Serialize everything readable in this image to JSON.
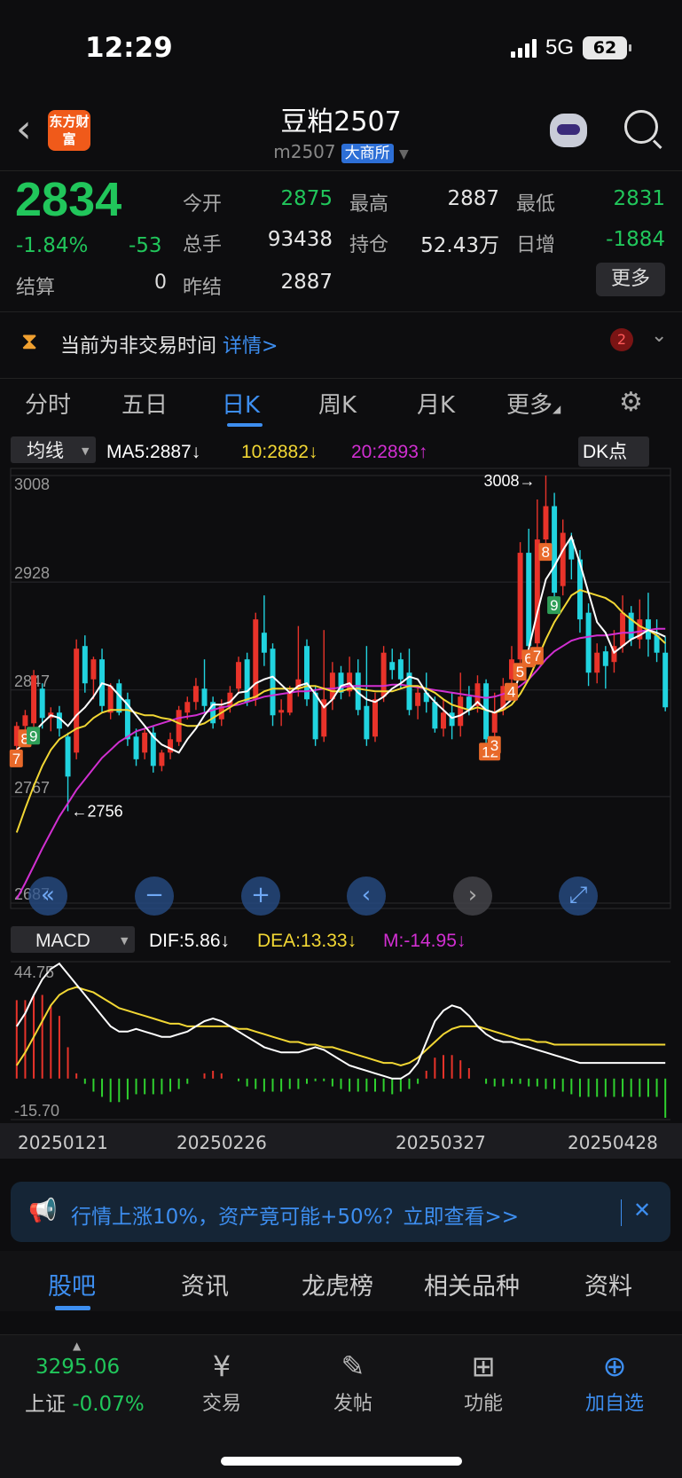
{
  "status": {
    "time": "12:29",
    "network": "5G",
    "battery": "62"
  },
  "header": {
    "logo": "东方财富",
    "title": "豆粕2507",
    "code": "m2507",
    "exchange": "大商所"
  },
  "quote": {
    "price": "2834",
    "pct": "-1.84%",
    "change": "-53",
    "settle_label": "结算",
    "settle_value": "0",
    "fields": [
      {
        "label": "今开",
        "value": "2875",
        "color": "green"
      },
      {
        "label": "最高",
        "value": "2887",
        "color": "white"
      },
      {
        "label": "最低",
        "value": "2831",
        "color": "green"
      },
      {
        "label": "总手",
        "value": "93438",
        "color": "white"
      },
      {
        "label": "持仓",
        "value": "52.43万",
        "color": "white"
      },
      {
        "label": "日增",
        "value": "-1884",
        "color": "green"
      },
      {
        "label": "昨结",
        "value": "2887",
        "color": "white"
      }
    ],
    "more": "更多"
  },
  "notice": {
    "text": "当前为非交易时间",
    "link": "详情>",
    "badge": "2"
  },
  "period_tabs": [
    "分时",
    "五日",
    "日K",
    "周K",
    "月K",
    "更多"
  ],
  "active_period": 2,
  "chart_data": {
    "type": "candlestick",
    "indicator_select": "均线",
    "ma_labels": {
      "ma5": "MA5:2887↓",
      "ma10": "10:2882↓",
      "ma20": "20:2893↑"
    },
    "dk_button": "DK点",
    "y_ticks": [
      "3008",
      "2928",
      "2847",
      "2767",
      "2687"
    ],
    "ylim": [
      2687,
      3008
    ],
    "max_label": "3008→",
    "min_label": "←2756",
    "dates": [
      "20250121",
      "20250226",
      "20250327",
      "20250428"
    ],
    "candles": [
      [
        2805,
        2820,
        2790,
        2823
      ],
      [
        2820,
        2828,
        2805,
        2832
      ],
      [
        2822,
        2858,
        2815,
        2862
      ],
      [
        2848,
        2826,
        2818,
        2852
      ],
      [
        2826,
        2830,
        2816,
        2834
      ],
      [
        2830,
        2818,
        2812,
        2835
      ],
      [
        2812,
        2782,
        2756,
        2815
      ],
      [
        2800,
        2878,
        2795,
        2885
      ],
      [
        2880,
        2852,
        2845,
        2888
      ],
      [
        2855,
        2870,
        2840,
        2872
      ],
      [
        2870,
        2835,
        2830,
        2878
      ],
      [
        2830,
        2850,
        2825,
        2852
      ],
      [
        2852,
        2830,
        2828,
        2855
      ],
      [
        2840,
        2810,
        2805,
        2845
      ],
      [
        2812,
        2795,
        2790,
        2818
      ],
      [
        2800,
        2815,
        2795,
        2818
      ],
      [
        2815,
        2790,
        2785,
        2820
      ],
      [
        2790,
        2800,
        2786,
        2802
      ],
      [
        2800,
        2810,
        2795,
        2815
      ],
      [
        2808,
        2832,
        2805,
        2835
      ],
      [
        2830,
        2838,
        2825,
        2842
      ],
      [
        2838,
        2850,
        2832,
        2856
      ],
      [
        2848,
        2835,
        2830,
        2870
      ],
      [
        2838,
        2822,
        2818,
        2842
      ],
      [
        2825,
        2835,
        2820,
        2840
      ],
      [
        2835,
        2845,
        2830,
        2850
      ],
      [
        2848,
        2868,
        2845,
        2872
      ],
      [
        2870,
        2838,
        2835,
        2875
      ],
      [
        2840,
        2900,
        2835,
        2905
      ],
      [
        2890,
        2875,
        2865,
        2918
      ],
      [
        2878,
        2828,
        2820,
        2882
      ],
      [
        2830,
        2832,
        2820,
        2840
      ],
      [
        2830,
        2845,
        2828,
        2850
      ],
      [
        2848,
        2855,
        2842,
        2895
      ],
      [
        2880,
        2840,
        2835,
        2885
      ],
      [
        2845,
        2810,
        2805,
        2850
      ],
      [
        2812,
        2840,
        2808,
        2892
      ],
      [
        2840,
        2860,
        2832,
        2868
      ],
      [
        2860,
        2845,
        2840,
        2865
      ],
      [
        2846,
        2860,
        2842,
        2872
      ],
      [
        2860,
        2832,
        2828,
        2870
      ],
      [
        2835,
        2810,
        2805,
        2880
      ],
      [
        2812,
        2840,
        2808,
        2845
      ],
      [
        2842,
        2875,
        2838,
        2880
      ],
      [
        2868,
        2862,
        2855,
        2878
      ],
      [
        2870,
        2855,
        2848,
        2875
      ],
      [
        2860,
        2832,
        2828,
        2878
      ],
      [
        2835,
        2845,
        2825,
        2850
      ],
      [
        2845,
        2838,
        2830,
        2860
      ],
      [
        2838,
        2818,
        2815,
        2842
      ],
      [
        2818,
        2830,
        2812,
        2840
      ],
      [
        2830,
        2820,
        2810,
        2845
      ],
      [
        2820,
        2842,
        2812,
        2860
      ],
      [
        2842,
        2832,
        2828,
        2850
      ],
      [
        2835,
        2852,
        2830,
        2858
      ],
      [
        2852,
        2810,
        2806,
        2855
      ],
      [
        2815,
        2830,
        2810,
        2845
      ],
      [
        2832,
        2850,
        2828,
        2856
      ],
      [
        2855,
        2870,
        2850,
        2880
      ],
      [
        2870,
        2950,
        2865,
        2958
      ],
      [
        2950,
        2880,
        2875,
        2968
      ],
      [
        2882,
        2960,
        2878,
        2990
      ],
      [
        2960,
        2985,
        2950,
        3008
      ],
      [
        2985,
        2920,
        2912,
        2995
      ],
      [
        2925,
        2965,
        2918,
        2975
      ],
      [
        2960,
        2945,
        2930,
        2965
      ],
      [
        2945,
        2900,
        2890,
        2952
      ],
      [
        2905,
        2860,
        2850,
        2912
      ],
      [
        2860,
        2875,
        2852,
        2882
      ],
      [
        2876,
        2865,
        2848,
        2880
      ],
      [
        2868,
        2880,
        2860,
        2892
      ],
      [
        2880,
        2905,
        2875,
        2918
      ],
      [
        2905,
        2885,
        2880,
        2910
      ],
      [
        2885,
        2900,
        2878,
        2915
      ],
      [
        2900,
        2885,
        2872,
        2920
      ],
      [
        2888,
        2875,
        2868,
        2900
      ],
      [
        2875,
        2834,
        2831,
        2887
      ]
    ],
    "ma5": [
      2802,
      2808,
      2815,
      2822,
      2828,
      2826,
      2820,
      2828,
      2834,
      2842,
      2852,
      2850,
      2843,
      2836,
      2828,
      2820,
      2812,
      2806,
      2803,
      2800,
      2810,
      2818,
      2828,
      2836,
      2836,
      2838,
      2845,
      2846,
      2852,
      2855,
      2857,
      2851,
      2845,
      2850,
      2852,
      2844,
      2834,
      2840,
      2850,
      2852,
      2845,
      2840,
      2838,
      2842,
      2848,
      2852,
      2857,
      2855,
      2845,
      2838,
      2832,
      2826,
      2828,
      2832,
      2838,
      2832,
      2830,
      2834,
      2840,
      2860,
      2878,
      2905,
      2930,
      2940,
      2952,
      2962,
      2942,
      2920,
      2898,
      2890,
      2875,
      2880,
      2885,
      2888,
      2892,
      2890,
      2887
    ],
    "ma10": [
      2740,
      2758,
      2775,
      2790,
      2802,
      2810,
      2814,
      2818,
      2820,
      2826,
      2830,
      2832,
      2832,
      2832,
      2830,
      2828,
      2828,
      2826,
      2825,
      2822,
      2820,
      2820,
      2822,
      2826,
      2830,
      2834,
      2838,
      2840,
      2842,
      2846,
      2848,
      2848,
      2848,
      2848,
      2850,
      2850,
      2848,
      2846,
      2846,
      2848,
      2848,
      2847,
      2846,
      2846,
      2846,
      2848,
      2850,
      2850,
      2848,
      2845,
      2840,
      2836,
      2834,
      2832,
      2834,
      2832,
      2830,
      2832,
      2836,
      2844,
      2855,
      2870,
      2885,
      2898,
      2908,
      2918,
      2922,
      2920,
      2918,
      2916,
      2912,
      2905,
      2900,
      2895,
      2892,
      2888,
      2882
    ],
    "ma20": [
      2690,
      2702,
      2715,
      2728,
      2740,
      2752,
      2762,
      2772,
      2780,
      2788,
      2796,
      2802,
      2808,
      2812,
      2816,
      2818,
      2820,
      2822,
      2824,
      2826,
      2827,
      2828,
      2830,
      2832,
      2834,
      2835,
      2836,
      2838,
      2840,
      2842,
      2843,
      2844,
      2845,
      2846,
      2846,
      2847,
      2848,
      2848,
      2849,
      2850,
      2850,
      2850,
      2850,
      2850,
      2851,
      2851,
      2850,
      2849,
      2848,
      2847,
      2846,
      2845,
      2844,
      2843,
      2842,
      2841,
      2842,
      2844,
      2846,
      2850,
      2855,
      2862,
      2870,
      2876,
      2880,
      2884,
      2886,
      2887,
      2888,
      2888,
      2889,
      2890,
      2890,
      2891,
      2892,
      2893,
      2893
    ],
    "annotations": [
      {
        "label": "7",
        "bar": 0,
        "color": "#e8692a"
      },
      {
        "label": "8",
        "bar": 1,
        "color": "#e8692a"
      },
      {
        "label": "9",
        "bar": 2,
        "color": "#2f9e58"
      },
      {
        "label": "12",
        "bar": 55,
        "color": "#e8692a"
      },
      {
        "label": "3",
        "bar": 56,
        "color": "#e8692a"
      },
      {
        "label": "4",
        "bar": 58,
        "color": "#e8692a"
      },
      {
        "label": "5",
        "bar": 59,
        "color": "#e8692a"
      },
      {
        "label": "6",
        "bar": 60,
        "color": "#e8692a"
      },
      {
        "label": "7",
        "bar": 61,
        "color": "#e8692a"
      },
      {
        "label": "8",
        "bar": 62,
        "color": "#e8692a"
      },
      {
        "label": "9",
        "bar": 63,
        "color": "#2f9e58"
      }
    ]
  },
  "macd": {
    "select": "MACD",
    "dif_label": "DIF:5.86↓",
    "dea_label": "DEA:13.33↓",
    "m_label": "M:-14.95↓",
    "ylim": [
      -15.7,
      44.75
    ],
    "y_ticks": [
      "44.75",
      "-15.70"
    ],
    "dif": [
      20,
      25,
      32,
      38,
      42,
      44,
      40,
      36,
      32,
      28,
      24,
      20,
      18,
      18,
      19,
      18,
      17,
      16,
      16,
      17,
      18,
      20,
      22,
      23,
      22,
      20,
      18,
      16,
      14,
      12,
      11,
      10,
      10,
      10,
      11,
      12,
      11,
      9,
      7,
      5,
      4,
      3,
      2,
      1,
      0,
      0,
      2,
      6,
      14,
      22,
      26,
      28,
      27,
      24,
      20,
      17,
      15,
      14,
      14,
      13,
      12,
      11,
      10,
      9,
      8,
      7,
      6,
      6,
      6,
      6,
      6,
      6,
      6,
      6,
      6,
      6,
      6
    ],
    "dea": [
      5,
      10,
      16,
      22,
      28,
      32,
      34,
      35,
      34,
      33,
      31,
      29,
      27,
      26,
      25,
      24,
      23,
      22,
      21,
      21,
      20,
      20,
      20,
      20,
      20,
      20,
      19,
      19,
      18,
      17,
      16,
      15,
      14,
      14,
      13,
      13,
      12,
      12,
      11,
      10,
      9,
      8,
      7,
      6,
      6,
      5,
      6,
      8,
      11,
      14,
      17,
      19,
      20,
      20,
      20,
      19,
      18,
      17,
      16,
      15,
      15,
      14,
      14,
      13,
      13,
      13,
      13,
      13,
      13,
      13,
      13,
      13,
      13,
      13,
      13,
      13,
      13
    ],
    "m": [
      30,
      30,
      32,
      32,
      28,
      24,
      12,
      2,
      -2,
      -5,
      -7,
      -9,
      -9,
      -8,
      -6,
      -6,
      -6,
      -6,
      -5,
      -4,
      -2,
      0,
      2,
      3,
      2,
      0,
      -1,
      -3,
      -4,
      -5,
      -5,
      -5,
      -4,
      -4,
      -2,
      -1,
      -1,
      -3,
      -4,
      -5,
      -5,
      -5,
      -5,
      -5,
      -6,
      -5,
      -4,
      -2,
      3,
      8,
      9,
      9,
      7,
      4,
      0,
      -2,
      -3,
      -3,
      -2,
      -2,
      -3,
      -3,
      -4,
      -4,
      -5,
      -6,
      -7,
      -7,
      -7,
      -7,
      -7,
      -7,
      -7,
      -7,
      -7,
      -7,
      -15
    ]
  },
  "ad": {
    "text": "行情上涨10%，资产竟可能+50%？立即查看>>"
  },
  "content_tabs": [
    "股吧",
    "资讯",
    "龙虎榜",
    "相关品种",
    "资料"
  ],
  "active_content_tab": 0,
  "bottom_nav": {
    "index_value": "3295.06",
    "index_name": "上证",
    "index_change": "-0.07%",
    "items": [
      {
        "label": "交易",
        "icon": "trade-icon"
      },
      {
        "label": "发帖",
        "icon": "edit-icon"
      },
      {
        "label": "功能",
        "icon": "grid-icon"
      },
      {
        "label": "加自选",
        "icon": "add-circle-icon"
      }
    ]
  },
  "colors": {
    "up": "#e8332a",
    "down": "#21d3df",
    "ma5": "#ffffff",
    "ma10": "#f2d734",
    "ma20": "#d12fd1",
    "accent": "#3d8ef0",
    "green": "#21c65b"
  }
}
